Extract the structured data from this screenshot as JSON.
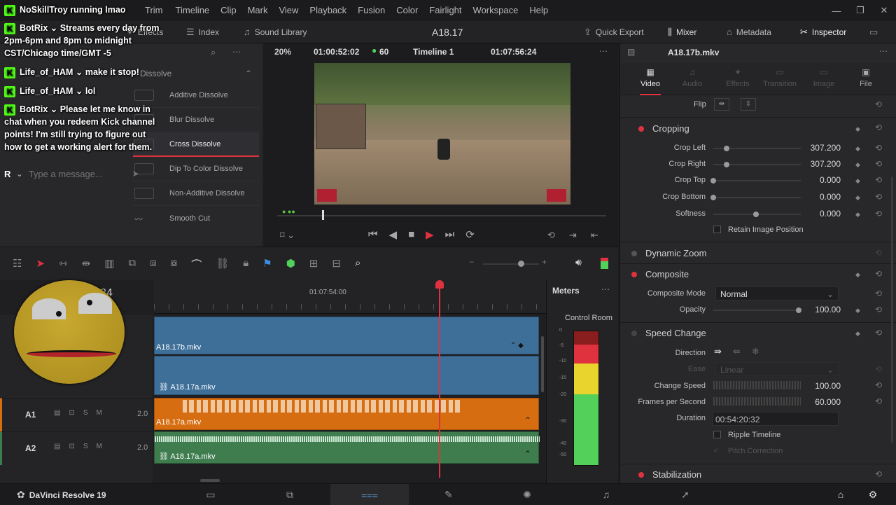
{
  "menu": [
    "Trim",
    "Timeline",
    "Clip",
    "Mark",
    "View",
    "Playback",
    "Fusion",
    "Color",
    "Fairlight",
    "Workspace",
    "Help"
  ],
  "toolbar": {
    "effects": "Effects",
    "index": "Index",
    "sound_library": "Sound Library",
    "project_name": "A18.17",
    "quick_export": "Quick Export",
    "mixer": "Mixer",
    "metadata": "Metadata",
    "inspector": "Inspector"
  },
  "viewer": {
    "zoom": "20%",
    "timecode_left": "01:00:52:02",
    "fps": "60",
    "timeline_name": "Timeline 1",
    "timecode_right": "01:07:56:24",
    "clip_name": "A18.17b.mkv"
  },
  "effects": {
    "category": "Dissolve",
    "items": [
      "Additive Dissolve",
      "Blur Dissolve",
      "Cross Dissolve",
      "Dip To Color Dissolve",
      "Non-Additive Dissolve",
      "Smooth Cut"
    ]
  },
  "inspector": {
    "tabs": [
      "Video",
      "Audio",
      "Effects",
      "Transition",
      "Image",
      "File"
    ],
    "flip_label": "Flip",
    "cropping": {
      "title": "Cropping",
      "rows": [
        {
          "label": "Crop Left",
          "value": "307.200"
        },
        {
          "label": "Crop Right",
          "value": "307.200"
        },
        {
          "label": "Crop Top",
          "value": "0.000"
        },
        {
          "label": "Crop Bottom",
          "value": "0.000"
        },
        {
          "label": "Softness",
          "value": "0.000"
        }
      ],
      "retain": "Retain Image Position"
    },
    "dynamic_zoom": "Dynamic Zoom",
    "composite": {
      "title": "Composite",
      "mode_label": "Composite Mode",
      "mode_value": "Normal",
      "opacity_label": "Opacity",
      "opacity_value": "100.00"
    },
    "speed_change": {
      "title": "Speed Change",
      "direction_label": "Direction",
      "ease_label": "Ease",
      "ease_value": "Linear",
      "change_speed_label": "Change Speed",
      "change_speed_value": "100.00",
      "fps_label": "Frames per Second",
      "fps_value": "60.000",
      "duration_label": "Duration",
      "duration_value": "00:54:20:32",
      "ripple": "Ripple Timeline",
      "pitch": "Pitch Correction"
    },
    "stabilization": "Stabilization"
  },
  "timeline": {
    "ruler_time": "01:07:54:00",
    "timecode_partial": "24",
    "clips": {
      "v2": "A18.17b.mkv",
      "v1": "A18.17a.mkv",
      "a1": "A18.17a.mkv",
      "a2": "A18.17a.mkv"
    },
    "tracks": [
      {
        "name": "A1",
        "level": "2.0"
      },
      {
        "name": "A2",
        "level": "2.0"
      }
    ]
  },
  "meters": {
    "title": "Meters",
    "room": "Control Room",
    "scale": [
      "0",
      "-5",
      "-10",
      "-15",
      "-20",
      "-30",
      "-40",
      "-50"
    ]
  },
  "bottom": {
    "app": "DaVinci Resolve 19"
  },
  "chat": {
    "messages": [
      {
        "user": "NoSkillTroy",
        "text": "running lmao"
      },
      {
        "user": "BotRix",
        "text": "Streams every day from 2pm-6pm and 8pm to midnight CST/Chicago time/GMT -5"
      },
      {
        "user": "Life_of_HAM",
        "text": "make it stop!"
      },
      {
        "user": "Life_of_HAM",
        "text": "lol"
      },
      {
        "user": "BotRix",
        "text": "Please let me know in chat when you redeem Kick channel points! I'm still trying to figure out how to get a working alert for them."
      }
    ],
    "placeholder": "Type a message...",
    "avatar_letter": "R"
  },
  "colors": {
    "accent_red": "#e0323e",
    "v_clip": "#3e6f99",
    "a1_clip": "#d66d10",
    "a2_clip": "#3f7d4f",
    "kick_green": "#53fc18"
  }
}
